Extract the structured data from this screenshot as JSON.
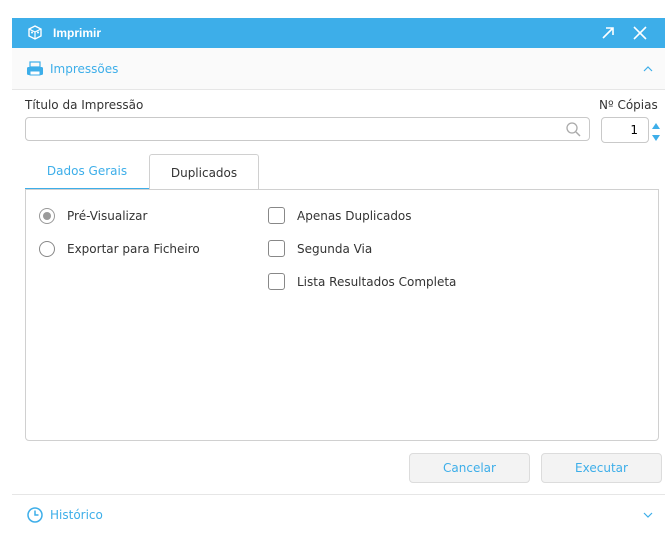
{
  "window": {
    "title": "Imprimir",
    "app_icon": "cube-icon",
    "actions": [
      "expand-icon",
      "close-icon"
    ]
  },
  "accent": "#3daee9",
  "impressoes": {
    "label": "Impressões",
    "icon": "printer-icon",
    "chevron": "chevron-up-icon"
  },
  "form": {
    "title_label": "Título da Impressão",
    "title_value": "",
    "copies_label": "Nº Cópias",
    "copies_value": "1"
  },
  "tabs": [
    {
      "label": "Dados Gerais",
      "active": true
    },
    {
      "label": "Duplicados",
      "active": false
    }
  ],
  "radios": [
    {
      "label": "Pré-Visualizar",
      "checked": true
    },
    {
      "label": "Exportar para Ficheiro",
      "checked": false
    }
  ],
  "checkboxes": [
    {
      "label": "Apenas Duplicados",
      "checked": false
    },
    {
      "label": "Segunda Via",
      "checked": false
    },
    {
      "label": "Lista Resultados Completa",
      "checked": false
    }
  ],
  "buttons": {
    "cancel": "Cancelar",
    "execute": "Executar"
  },
  "historico": {
    "label": "Histórico",
    "icon": "clock-icon",
    "chevron": "chevron-down-icon"
  }
}
